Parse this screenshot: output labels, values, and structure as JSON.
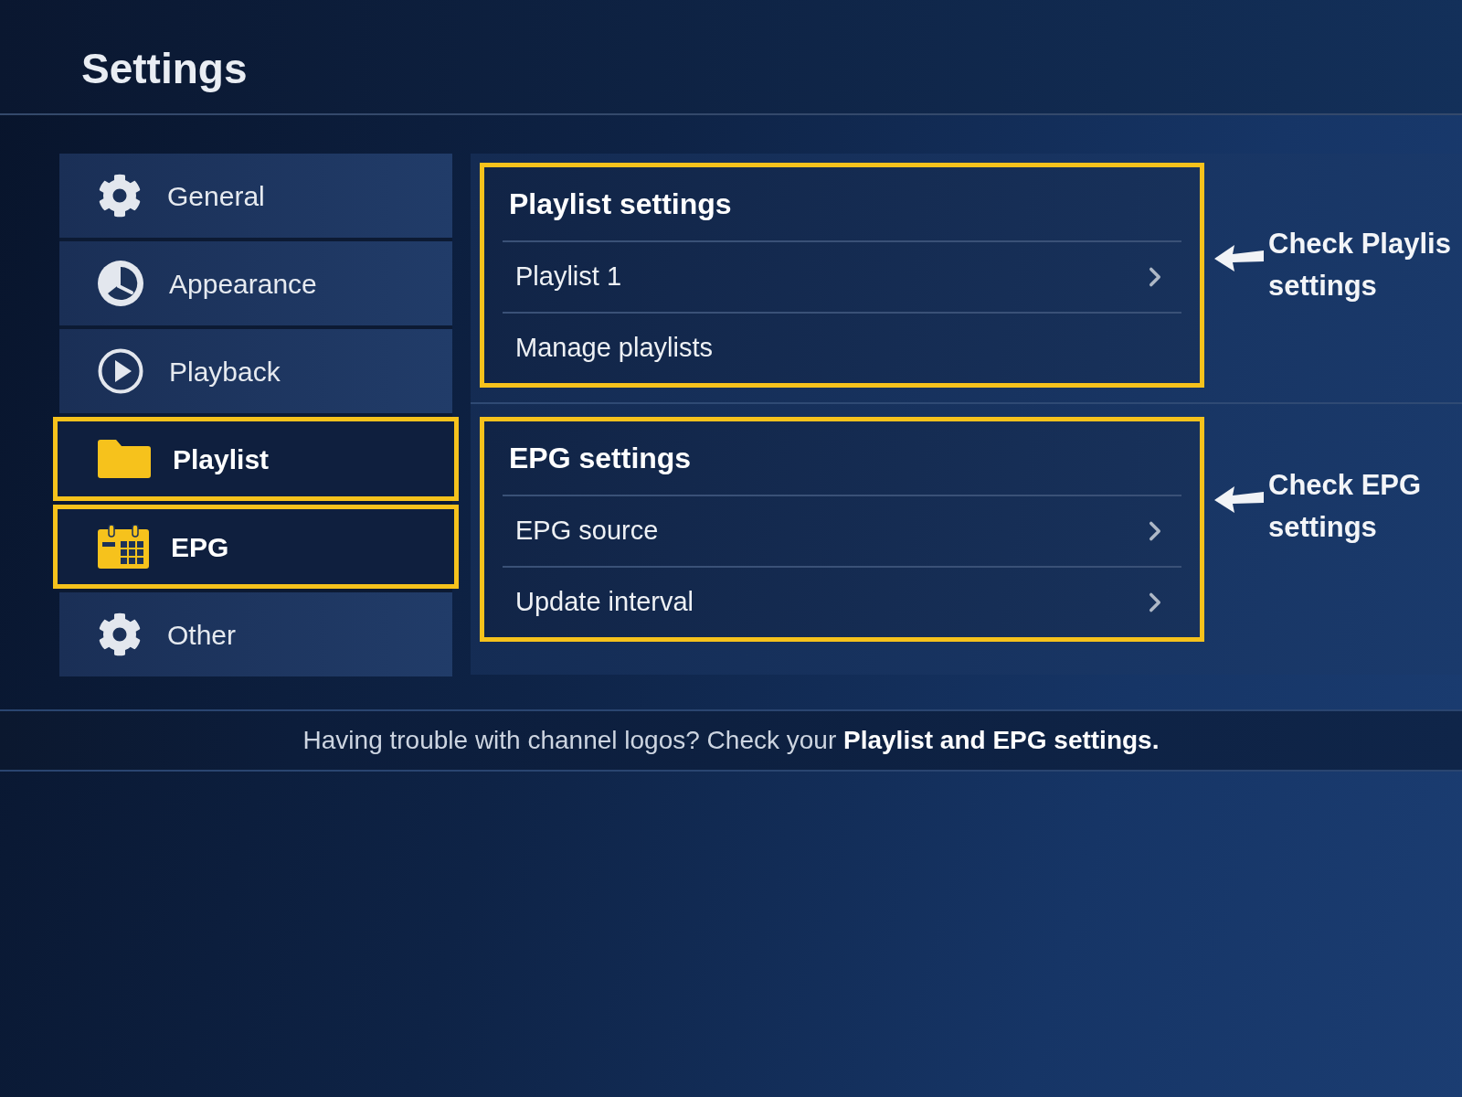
{
  "header": {
    "title": "Settings"
  },
  "sidebar": {
    "items": [
      {
        "label": "General",
        "highlighted": false
      },
      {
        "label": "Appearance",
        "highlighted": false
      },
      {
        "label": "Playback",
        "highlighted": false
      },
      {
        "label": "Playlist",
        "highlighted": true
      },
      {
        "label": "EPG",
        "highlighted": true
      },
      {
        "label": "Other",
        "highlighted": false
      }
    ]
  },
  "sections": [
    {
      "title": "Playlist settings",
      "highlighted": true,
      "rows": [
        {
          "label": "Playlist 1",
          "chevron": true
        },
        {
          "label": "Manage playlists",
          "chevron": false
        }
      ],
      "callout": {
        "lines": [
          "Check Playlis",
          "settings"
        ]
      }
    },
    {
      "title": "EPG settings",
      "highlighted": true,
      "rows": [
        {
          "label": "EPG source",
          "chevron": true
        },
        {
          "label": "Update interval",
          "chevron": true
        }
      ],
      "callout": {
        "lines": [
          "Check EPG",
          "settings"
        ]
      }
    }
  ],
  "footer": {
    "text": "Having trouble with channel logos? Check your **Playlist and EPG settings.**"
  }
}
